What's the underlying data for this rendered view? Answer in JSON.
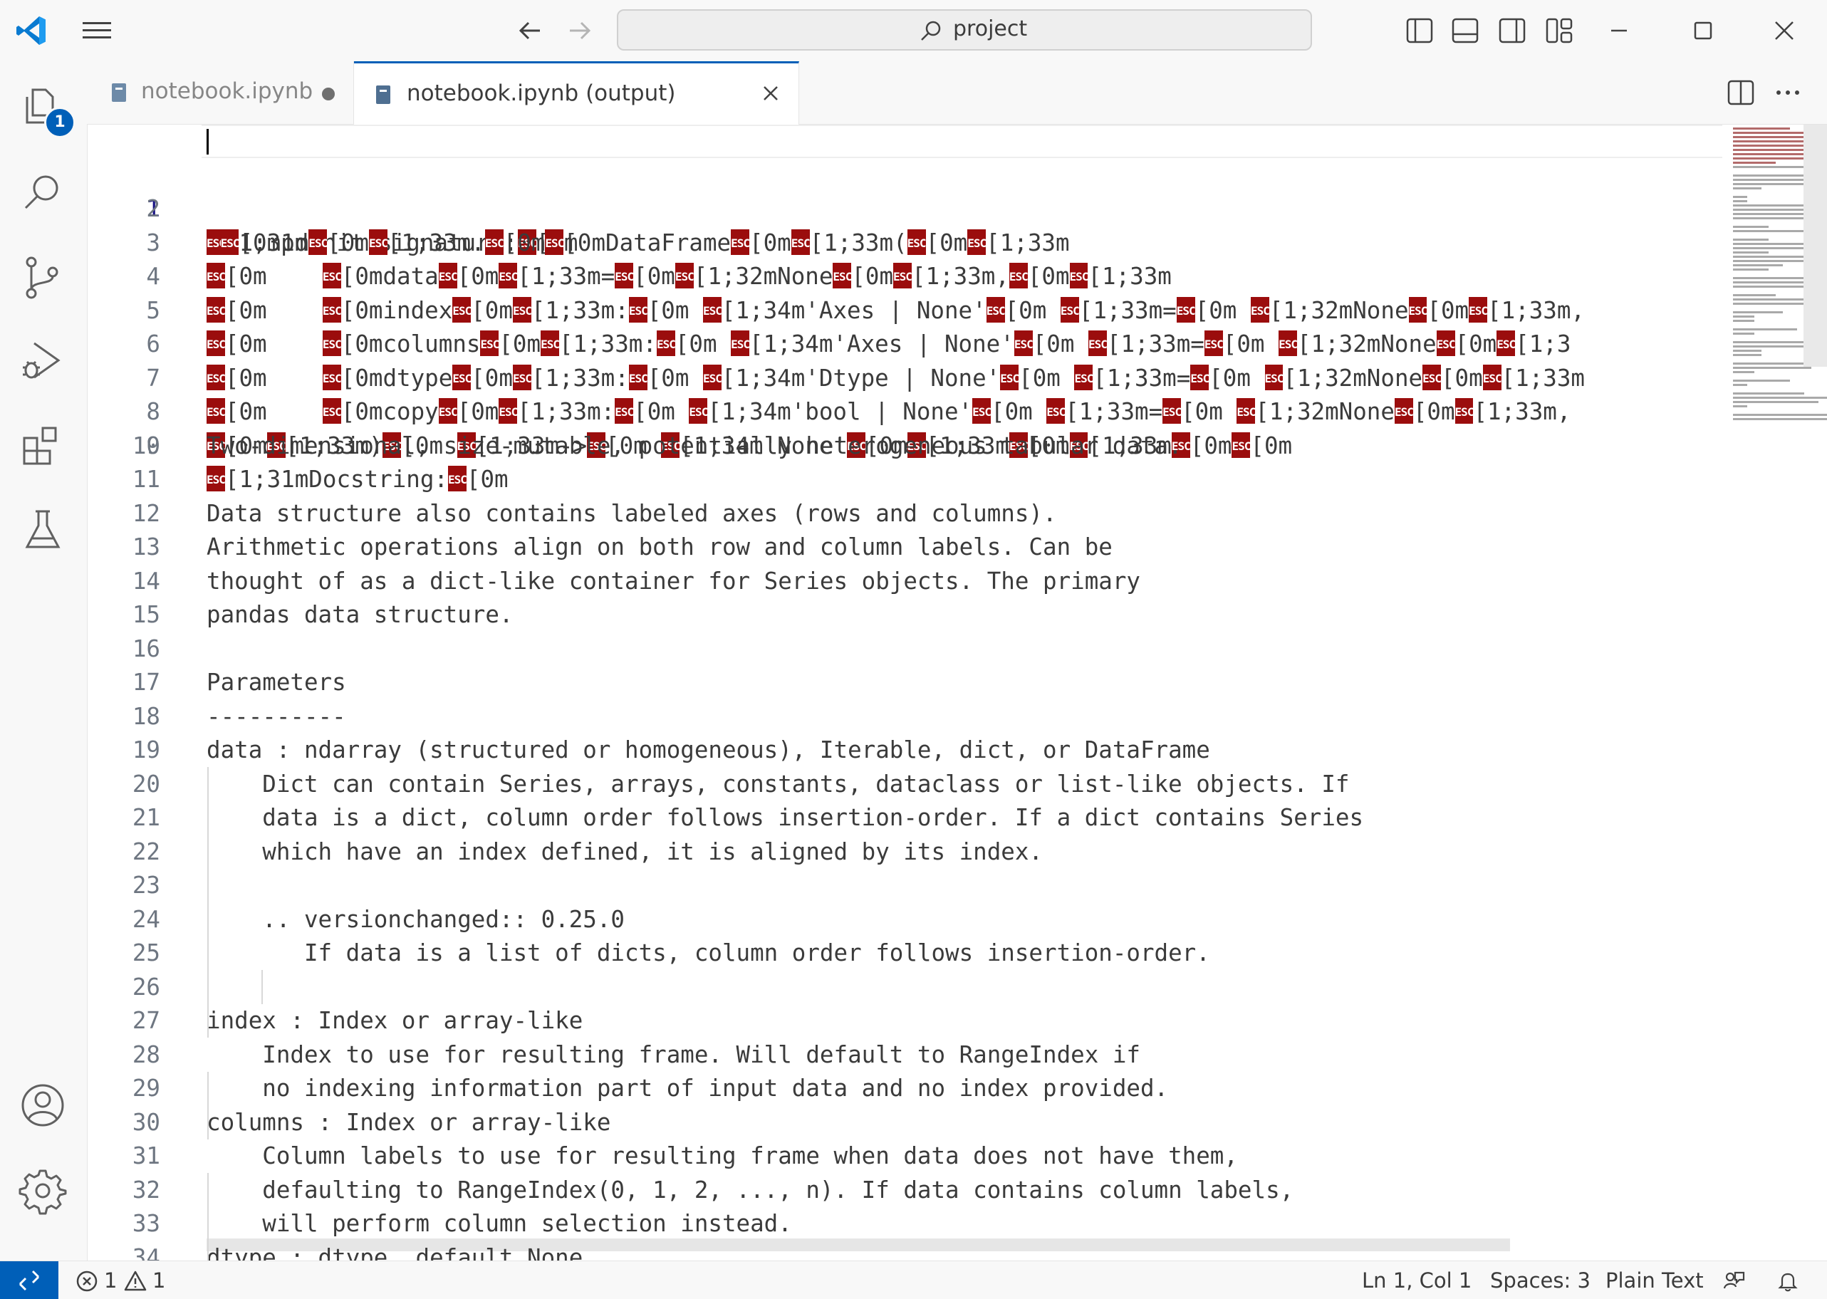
{
  "titlebar": {
    "search_label": "project"
  },
  "activity": {
    "explorer_badge": "1"
  },
  "tabs": [
    {
      "label": "notebook.ipynb",
      "state": "modified"
    },
    {
      "label": "notebook.ipynb (output)",
      "state": "active"
    }
  ],
  "editor": {
    "lines": [
      {
        "n": "1"
      },
      {
        "n": "2"
      },
      {
        "n": "3"
      },
      {
        "n": "4"
      },
      {
        "n": "5"
      },
      {
        "n": "6"
      },
      {
        "n": "7"
      },
      {
        "n": "8"
      },
      {
        "n": "9"
      },
      {
        "n": "10",
        "text": "Two-dimensional, size-mutable, potentially heterogeneous tabular data."
      },
      {
        "n": "11",
        "text": ""
      },
      {
        "n": "12",
        "text": "Data structure also contains labeled axes (rows and columns)."
      },
      {
        "n": "13",
        "text": "Arithmetic operations align on both row and column labels. Can be"
      },
      {
        "n": "14",
        "text": "thought of as a dict-like container for Series objects. The primary"
      },
      {
        "n": "15",
        "text": "pandas data structure."
      },
      {
        "n": "16",
        "text": ""
      },
      {
        "n": "17",
        "text": "Parameters"
      },
      {
        "n": "18",
        "text": "----------"
      },
      {
        "n": "19",
        "text": "data : ndarray (structured or homogeneous), Iterable, dict, or DataFrame"
      },
      {
        "n": "20",
        "text": "    Dict can contain Series, arrays, constants, dataclass or list-like objects. If"
      },
      {
        "n": "21",
        "text": "    data is a dict, column order follows insertion-order. If a dict contains Series"
      },
      {
        "n": "22",
        "text": "    which have an index defined, it is aligned by its index."
      },
      {
        "n": "23",
        "text": ""
      },
      {
        "n": "24",
        "text": "    .. versionchanged:: 0.25.0"
      },
      {
        "n": "25",
        "text": "       If data is a list of dicts, column order follows insertion-order."
      },
      {
        "n": "26",
        "text": ""
      },
      {
        "n": "27",
        "text": "index : Index or array-like"
      },
      {
        "n": "28",
        "text": "    Index to use for resulting frame. Will default to RangeIndex if"
      },
      {
        "n": "29",
        "text": "    no indexing information part of input data and no index provided."
      },
      {
        "n": "30",
        "text": "columns : Index or array-like"
      },
      {
        "n": "31",
        "text": "    Column labels to use for resulting frame when data does not have them,"
      },
      {
        "n": "32",
        "text": "    defaulting to RangeIndex(0, 1, 2, ..., n). If data contains column labels,"
      },
      {
        "n": "33",
        "text": "    will perform column selection instead."
      },
      {
        "n": "34",
        "text": "dtype : dtype, default None"
      }
    ],
    "esc_glyph": "ESC",
    "ansi": {
      "l1": [
        "[1;31mInit signature:",
        "[0m"
      ],
      "l2": [
        "[0mpd",
        "[0m",
        "[1;33m.",
        "[0m",
        "[0mDataFrame",
        "[0m",
        "[1;33m(",
        "[0m",
        "[1;33m"
      ],
      "l3": [
        "[0m    ",
        "[0mdata",
        "[0m",
        "[1;33m=",
        "[0m",
        "[1;32mNone",
        "[0m",
        "[1;33m,",
        "[0m",
        "[1;33m"
      ],
      "l4": [
        "[0m    ",
        "[0mindex",
        "[0m",
        "[1;33m:",
        "[0m ",
        "[1;34m'Axes | None'",
        "[0m ",
        "[1;33m=",
        "[0m ",
        "[1;32mNone",
        "[0m",
        "[1;33m,"
      ],
      "l5": [
        "[0m    ",
        "[0mcolumns",
        "[0m",
        "[1;33m:",
        "[0m ",
        "[1;34m'Axes | None'",
        "[0m ",
        "[1;33m=",
        "[0m ",
        "[1;32mNone",
        "[0m",
        "[1;3"
      ],
      "l6": [
        "[0m    ",
        "[0mdtype",
        "[0m",
        "[1;33m:",
        "[0m ",
        "[1;34m'Dtype | None'",
        "[0m ",
        "[1;33m=",
        "[0m ",
        "[1;32mNone",
        "[0m",
        "[1;33m"
      ],
      "l7": [
        "[0m    ",
        "[0mcopy",
        "[0m",
        "[1;33m:",
        "[0m ",
        "[1;34m'bool | None'",
        "[0m ",
        "[1;33m=",
        "[0m ",
        "[1;32mNone",
        "[0m",
        "[1;33m,"
      ],
      "l8": [
        "[0m",
        "[1;33m)",
        "[0m ",
        "[1;33m->",
        "[0m ",
        "[1;34m'None'",
        "[0m",
        "[1;33m",
        "[0m",
        "[1;33m",
        "[0m",
        "[0m"
      ],
      "l9": [
        "[1;31mDocstring:",
        "[0m"
      ]
    }
  },
  "status": {
    "errors": "1",
    "warnings": "1",
    "position": "Ln 1, Col 1",
    "spaces": "Spaces: 3",
    "language": "Plain Text"
  }
}
